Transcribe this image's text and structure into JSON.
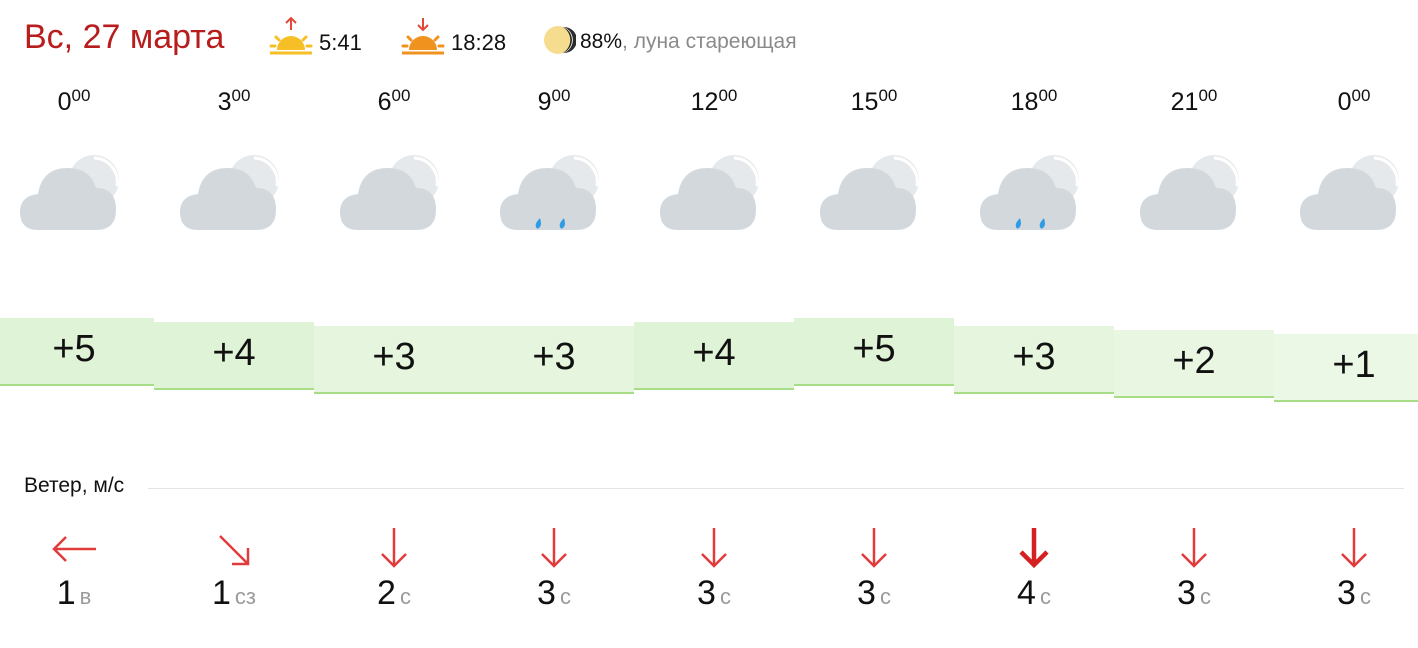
{
  "header": {
    "date": "Вс, 27 марта",
    "sunrise": "5:41",
    "sunset": "18:28",
    "moon_percent": "88%",
    "moon_phase": ", луна стареющая",
    "sunrise_icon": "sunrise-icon",
    "sunset_icon": "sunset-icon",
    "moon_icon": "moon-icon"
  },
  "columns": [
    {
      "hour": "0",
      "min": "00",
      "icon": "cloudy-icon",
      "temp": "+5",
      "wind_speed": "1",
      "wind_dir": "в"
    },
    {
      "hour": "3",
      "min": "00",
      "icon": "cloudy-icon",
      "temp": "+4",
      "wind_speed": "1",
      "wind_dir": "сз"
    },
    {
      "hour": "6",
      "min": "00",
      "icon": "cloudy-icon",
      "temp": "+3",
      "wind_speed": "2",
      "wind_dir": "с"
    },
    {
      "hour": "9",
      "min": "00",
      "icon": "cloudy-light-rain-icon",
      "temp": "+3",
      "wind_speed": "3",
      "wind_dir": "с"
    },
    {
      "hour": "12",
      "min": "00",
      "icon": "cloudy-icon",
      "temp": "+4",
      "wind_speed": "3",
      "wind_dir": "с"
    },
    {
      "hour": "15",
      "min": "00",
      "icon": "cloudy-icon",
      "temp": "+5",
      "wind_speed": "3",
      "wind_dir": "с"
    },
    {
      "hour": "18",
      "min": "00",
      "icon": "cloudy-light-rain-icon",
      "temp": "+3",
      "wind_speed": "4",
      "wind_dir": "с"
    },
    {
      "hour": "21",
      "min": "00",
      "icon": "cloudy-icon",
      "temp": "+2",
      "wind_speed": "3",
      "wind_dir": "с"
    },
    {
      "hour": "0",
      "min": "00",
      "icon": "cloudy-icon",
      "temp": "+1",
      "wind_speed": "3",
      "wind_dir": "с"
    }
  ],
  "wind_label": "Ветер, м/с",
  "colors": {
    "date_red": "#b81d1d",
    "wind_arrow_red": "#e23b3b",
    "wind_arrow_strong": "#d42020",
    "temp_band_warm": "#dff3d6",
    "temp_band_cool": "#ecf8e6",
    "temp_band_border": "#a6dd86",
    "cloud_gray": "#d3d8dd",
    "rain_blue": "#2e9be6"
  }
}
